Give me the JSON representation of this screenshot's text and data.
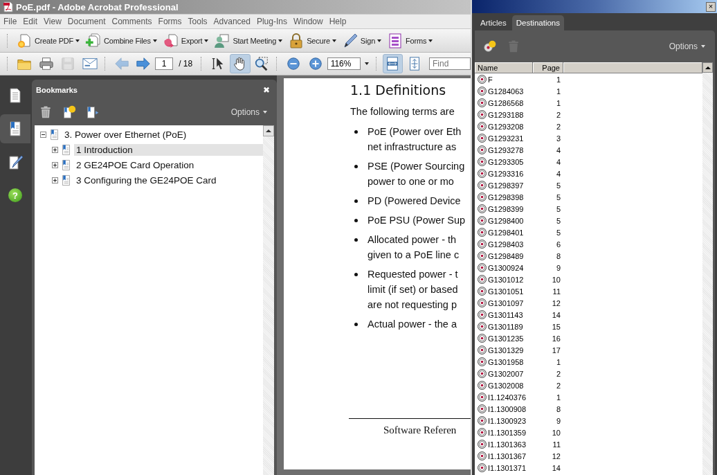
{
  "window": {
    "title": "PoE.pdf - Adobe Acrobat Professional"
  },
  "menu": [
    "File",
    "Edit",
    "View",
    "Document",
    "Comments",
    "Forms",
    "Tools",
    "Advanced",
    "Plug-Ins",
    "Window",
    "Help"
  ],
  "tasks_toolbar": [
    {
      "kind": "create",
      "label": "Create PDF"
    },
    {
      "kind": "combine",
      "label": "Combine Files"
    },
    {
      "kind": "export",
      "label": "Export"
    },
    {
      "kind": "meeting",
      "label": "Start Meeting"
    },
    {
      "kind": "secure",
      "label": "Secure"
    },
    {
      "kind": "sign",
      "label": "Sign"
    },
    {
      "kind": "forms",
      "label": "Forms"
    }
  ],
  "file_tools": [
    {
      "kind": "open",
      "disabled": false
    },
    {
      "kind": "print",
      "disabled": false
    },
    {
      "kind": "save",
      "disabled": true
    },
    {
      "kind": "email",
      "disabled": false
    }
  ],
  "page_nav": [
    {
      "kind": "previous",
      "disabled": true
    },
    {
      "kind": "next",
      "disabled": false
    }
  ],
  "page_number": "1",
  "page_count": "/ 18",
  "view_tools": [
    {
      "kind": "select",
      "selected": false
    },
    {
      "kind": "hand",
      "selected": true
    },
    {
      "kind": "marquee",
      "selected": false
    }
  ],
  "zoom_tools": [
    {
      "kind": "zoom-out"
    },
    {
      "kind": "zoom-in"
    }
  ],
  "zoom": "116%",
  "fit_tools": [
    {
      "kind": "fit-width",
      "selected": true
    },
    {
      "kind": "fit-page",
      "selected": false
    }
  ],
  "find": {
    "placeholder": "Find"
  },
  "side_tabs": [
    {
      "kind": "pages",
      "selected": false
    },
    {
      "kind": "bookmarks",
      "selected": true
    },
    {
      "kind": "signatures",
      "selected": false
    },
    {
      "kind": "help",
      "symbol": "?",
      "selected": false
    }
  ],
  "bookmarks": {
    "title": "Bookmarks",
    "close": "✖",
    "options": "Options",
    "items": [
      {
        "label": "3. Power over Ethernet (PoE)",
        "expanded": true,
        "selected": false,
        "children": [
          {
            "label": "1 Introduction",
            "expanded": false,
            "selected": true
          },
          {
            "label": "2 GE24POE Card Operation",
            "expanded": false,
            "selected": false
          },
          {
            "label": "3 Configuring the GE24POE Card",
            "expanded": false,
            "selected": false
          }
        ]
      }
    ]
  },
  "document": {
    "heading": "1.1  Definitions",
    "intro": "The following terms are",
    "bullets": [
      [
        "PoE (Power over Eth",
        "net infrastructure as"
      ],
      [
        "PSE (Power Sourcing",
        "power to one or mo"
      ],
      [
        "PD (Powered Device"
      ],
      [
        "PoE PSU (Power Sup"
      ],
      [
        "Allocated power - th",
        "given to a PoE line c"
      ],
      [
        "Requested power - t",
        "limit (if set) or based",
        "are not requesting p"
      ],
      [
        "Actual power - the a"
      ]
    ],
    "footer": "Software Referen"
  },
  "destinations_panel": {
    "close": "×",
    "tabs": [
      {
        "label": "Articles",
        "selected": false
      },
      {
        "label": "Destinations",
        "selected": true
      }
    ],
    "tools": [
      {
        "kind": "new",
        "disabled": false
      },
      {
        "kind": "delete",
        "disabled": true
      }
    ],
    "options": "Options",
    "columns": [
      "Name",
      "Page"
    ],
    "rows": [
      {
        "name": "F",
        "page": "1"
      },
      {
        "name": "G1284063",
        "page": "1"
      },
      {
        "name": "G1286568",
        "page": "1"
      },
      {
        "name": "G1293188",
        "page": "2"
      },
      {
        "name": "G1293208",
        "page": "2"
      },
      {
        "name": "G1293231",
        "page": "3"
      },
      {
        "name": "G1293278",
        "page": "4"
      },
      {
        "name": "G1293305",
        "page": "4"
      },
      {
        "name": "G1293316",
        "page": "4"
      },
      {
        "name": "G1298397",
        "page": "5"
      },
      {
        "name": "G1298398",
        "page": "5"
      },
      {
        "name": "G1298399",
        "page": "5"
      },
      {
        "name": "G1298400",
        "page": "5"
      },
      {
        "name": "G1298401",
        "page": "5"
      },
      {
        "name": "G1298403",
        "page": "6"
      },
      {
        "name": "G1298489",
        "page": "8"
      },
      {
        "name": "G1300924",
        "page": "9"
      },
      {
        "name": "G1301012",
        "page": "10"
      },
      {
        "name": "G1301051",
        "page": "11"
      },
      {
        "name": "G1301097",
        "page": "12"
      },
      {
        "name": "G1301143",
        "page": "14"
      },
      {
        "name": "G1301189",
        "page": "15"
      },
      {
        "name": "G1301235",
        "page": "16"
      },
      {
        "name": "G1301329",
        "page": "17"
      },
      {
        "name": "G1301958",
        "page": "1"
      },
      {
        "name": "G1302007",
        "page": "2"
      },
      {
        "name": "G1302008",
        "page": "2"
      },
      {
        "name": "I1.1240376",
        "page": "1"
      },
      {
        "name": "I1.1300908",
        "page": "8"
      },
      {
        "name": "I1.1300923",
        "page": "9"
      },
      {
        "name": "I1.1301359",
        "page": "10"
      },
      {
        "name": "I1.1301363",
        "page": "11"
      },
      {
        "name": "I1.1301367",
        "page": "12"
      },
      {
        "name": "I1.1301371",
        "page": "14"
      }
    ]
  }
}
